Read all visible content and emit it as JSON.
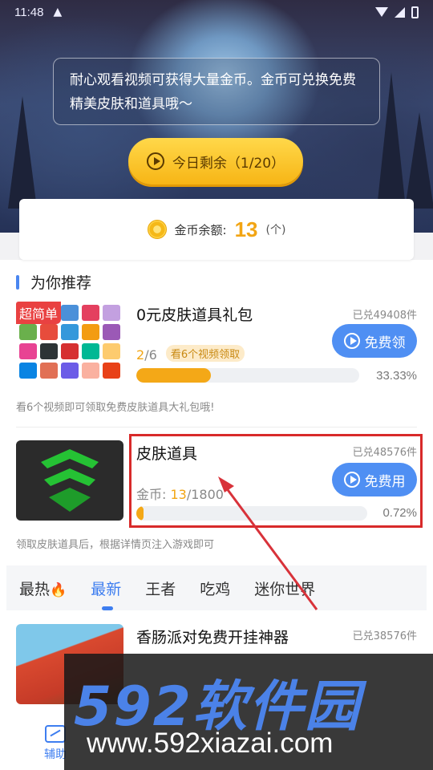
{
  "status_bar": {
    "time": "11:48",
    "warning": "▲"
  },
  "notice": {
    "text": "耐心观看视频可获得大量金币。金币可兑换免费精美皮肤和道具哦～"
  },
  "today_button": {
    "label": "今日剩余（1/20）"
  },
  "balance": {
    "label": "金币余额:",
    "value": "13",
    "unit": "(个)"
  },
  "section": {
    "title": "为你推荐"
  },
  "items": [
    {
      "tag": "超简单",
      "title": "0元皮肤道具礼包",
      "redeemed": "已兑49408件",
      "button": "免费领",
      "progress_done": "2",
      "progress_sep": "/6",
      "pill": "看6个视频领取",
      "percent": "33.33%",
      "progress_fraction": 0.3333,
      "desc": "看6个视频即可领取免费皮肤道具大礼包哦!"
    },
    {
      "title": "皮肤道具",
      "redeemed": "已兑48576件",
      "button": "免费用",
      "coin_label": "金币: ",
      "coin_have": "13",
      "coin_need": "/1800",
      "percent": "0.72%",
      "progress_fraction": 0.0072,
      "desc": "领取皮肤道具后，根据详情页注入游戏即可"
    },
    {
      "title": "香肠派对免费开挂神器",
      "redeemed": "已兑38576件"
    }
  ],
  "tabs": [
    {
      "label": "最热"
    },
    {
      "label": "最新"
    },
    {
      "label": "王者"
    },
    {
      "label": "吃鸡"
    },
    {
      "label": "迷你世界"
    }
  ],
  "flame_icon": "🔥",
  "bottom_nav": {
    "assist_label": "辅助"
  },
  "watermark": {
    "logo": "592软件园",
    "url": "www.592xiazai.com"
  },
  "colors": {
    "accent": "#4f8ff3",
    "gold": "#f2a514",
    "highlight": "#d82a2a"
  }
}
